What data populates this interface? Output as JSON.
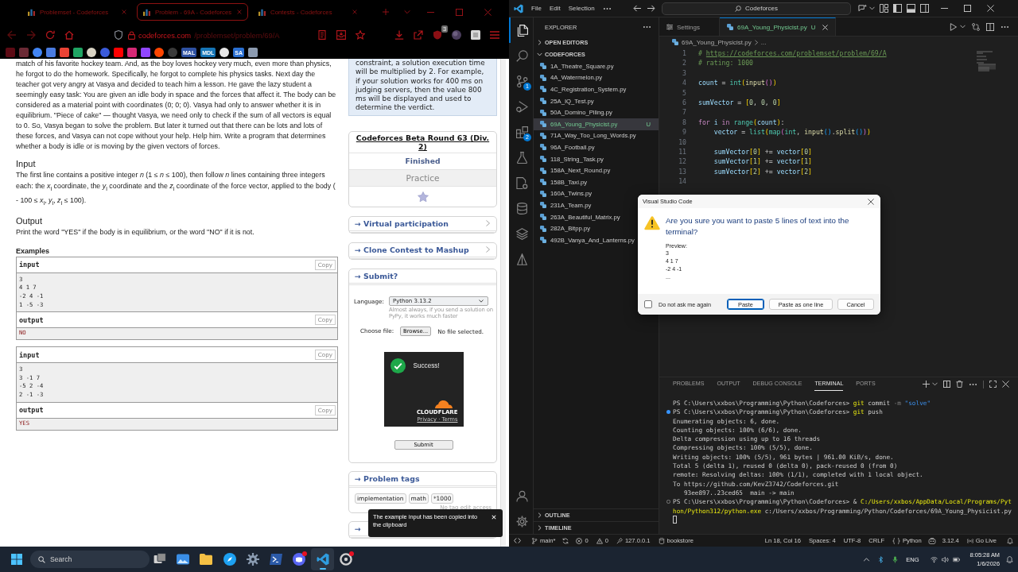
{
  "browser": {
    "tabs": [
      {
        "title": "Problemset - Codeforces",
        "selected": false
      },
      {
        "title": "Problem - 69A - Codeforces",
        "selected": true
      },
      {
        "title": "Contests - Codeforces",
        "selected": false
      }
    ],
    "url": {
      "host": "codeforces.com",
      "path": "/problemset/problem/69/A"
    },
    "extension_badge": "3",
    "bookmarks": [
      {
        "kind": "tile",
        "color": "#5c0a14"
      },
      {
        "kind": "tile",
        "color": "#6b2a35"
      },
      {
        "kind": "circle",
        "color": "#4285f4"
      },
      {
        "kind": "tile",
        "color": "#4a7be0"
      },
      {
        "kind": "tile",
        "color": "#ea4335"
      },
      {
        "kind": "tile",
        "color": "#1fa463"
      },
      {
        "kind": "circle",
        "color": "#d9d4c4"
      },
      {
        "kind": "circle",
        "color": "#3b5bdb"
      },
      {
        "kind": "tile",
        "color": "#ff0000"
      },
      {
        "kind": "tile",
        "color": "#d62976"
      },
      {
        "kind": "tile",
        "color": "#9146ff"
      },
      {
        "kind": "circle",
        "color": "#ff4500"
      },
      {
        "kind": "circle",
        "color": "#3a3a3a"
      },
      {
        "kind": "text",
        "label": "MAL",
        "color": "#2e51a2"
      },
      {
        "kind": "text",
        "label": "MDL",
        "color": "#1675b6"
      },
      {
        "kind": "circle",
        "color": "#e8e8e8"
      },
      {
        "kind": "text",
        "label": "SA",
        "color": "#2a6fd1"
      },
      {
        "kind": "tile",
        "color": "#8c9bb0"
      }
    ]
  },
  "problem": {
    "statement": "match of his favorite hockey team. And, as the boy loves hockey very much, even more than physics, he forgot to do the homework. Specifically, he forgot to complete his physics tasks. Next day the teacher got very angry at Vasya and decided to teach him a lesson. He gave the lazy student a seemingly easy task: You are given an idle body in space and the forces that affect it. The body can be considered as a material point with coordinates (0; 0; 0). Vasya had only to answer whether it is in equilibrium. \"Piece of cake\" — thought Vasya, we need only to check if the sum of all vectors is equal to 0. So, Vasya began to solve the problem. But later it turned out that there can be lots and lots of these forces, and Vasya can not cope without your help. Help him. Write a program that determines whether a body is idle or is moving by the given vectors of forces.",
    "sections": [
      {
        "title": "Input",
        "text": "The first line contains a positive integer *n* (1 ≤ *n* ≤ 100), then follow *n* lines containing three integers each: the *x*$_{i}$ coordinate, the *y*$_{i}$ coordinate and the *z*$_{i}$ coordinate of the force vector, applied to the body ( - 100 ≤ *x*$_{i}$, *y*$_{i}$, *z*$_{i}$ ≤ 100)."
      },
      {
        "title": "Output",
        "text": "Print the word \"YES\" if the body is in equilibrium, or the word \"NO\" if it is not."
      }
    ],
    "examples_title": "Examples",
    "examples": [
      {
        "input_label": "input",
        "input_copy": "Copy",
        "input_lines": [
          "3",
          "4 1 7",
          "-2 4 -1",
          "1 -5 -3"
        ],
        "output_label": "output",
        "output_copy": "Copy",
        "output_lines": [
          "NO"
        ]
      },
      {
        "input_label": "input",
        "input_copy": "Copy",
        "input_lines": [
          "3",
          "3 -1 7",
          "-5 2 -4",
          "2 -1 -3"
        ],
        "output_label": "output",
        "output_copy": "Copy",
        "output_lines": [
          "YES"
        ]
      }
    ]
  },
  "sidebar": {
    "note": "constraint, a solution execution time will be multiplied by 2. For example, if your solution works for 400 ms on judging servers, then the value 800 ms will be displayed and used to determine the verdict.",
    "contest": {
      "name": "Codeforces Beta Round 63 (Div. 2)",
      "status": "Finished",
      "mode": "Practice"
    },
    "links": [
      "→ Virtual participation",
      "→ Clone Contest to Mashup"
    ],
    "submit": {
      "title": "→ Submit?",
      "language_label": "Language:",
      "language": "Python 3.13.2",
      "language_hint": "Almost always, if you send a solution on PyPy, it works much faster",
      "file_label": "Choose file:",
      "browse": "Browse...",
      "file_status": "No file selected.",
      "captcha": {
        "status": "Success!",
        "brand": "CLOUDFLARE",
        "legal": "Privacy · Terms"
      },
      "button": "Submit"
    },
    "tags": {
      "title": "→ Problem tags",
      "items": [
        "implementation",
        "math",
        "*1000"
      ],
      "note": "No tag edit access"
    },
    "materials_title": "→"
  },
  "toast": {
    "text": "The example input has been copied into the clipboard"
  },
  "vscode": {
    "menu": [
      "File",
      "Edit",
      "Selection"
    ],
    "search": "Codeforces",
    "activity": [
      {
        "kind": "files",
        "selected": true
      },
      {
        "kind": "search",
        "selected": false
      },
      {
        "kind": "source-control",
        "selected": false,
        "badge": "1"
      },
      {
        "kind": "run",
        "selected": false
      },
      {
        "kind": "extensions",
        "selected": false,
        "badge": "2"
      },
      {
        "kind": "testing",
        "selected": false
      },
      {
        "kind": "remote",
        "selected": false
      },
      {
        "kind": "database",
        "selected": false
      },
      {
        "kind": "layers",
        "selected": false
      },
      {
        "kind": "deploy",
        "selected": false
      }
    ],
    "explorer": {
      "title": "EXPLORER",
      "sections": [
        {
          "title": "OPEN EDITORS",
          "expanded": false
        },
        {
          "title": "CODEFORCES",
          "expanded": true,
          "files": [
            {
              "name": "1A_Theatre_Square.py",
              "selected": false
            },
            {
              "name": "4A_Watermelon.py",
              "selected": false
            },
            {
              "name": "4C_Registration_System.py",
              "selected": false
            },
            {
              "name": "25A_IQ_Test.py",
              "selected": false
            },
            {
              "name": "50A_Domino_Piling.py",
              "selected": false
            },
            {
              "name": "69A_Young_Physicist.py",
              "selected": true,
              "status": "U"
            },
            {
              "name": "71A_Way_Too_Long_Words.py",
              "selected": false
            },
            {
              "name": "96A_Football.py",
              "selected": false
            },
            {
              "name": "118_String_Task.py",
              "selected": false
            },
            {
              "name": "158A_Next_Round.py",
              "selected": false
            },
            {
              "name": "158B_Taxi.py",
              "selected": false
            },
            {
              "name": "160A_Twins.py",
              "selected": false
            },
            {
              "name": "231A_Team.py",
              "selected": false
            },
            {
              "name": "263A_Beautiful_Matrix.py",
              "selected": false
            },
            {
              "name": "282A_Bitpp.py",
              "selected": false
            },
            {
              "name": "492B_Vanya_And_Lanterns.py",
              "selected": false
            }
          ]
        }
      ],
      "bottom_sections": [
        {
          "title": "OUTLINE",
          "expanded": false
        },
        {
          "title": "TIMELINE",
          "expanded": false
        }
      ]
    },
    "editor": {
      "tabs": [
        {
          "title": "Settings",
          "kind": "settings",
          "selected": false
        },
        {
          "title": "69A_Young_Physicist.py",
          "kind": "python",
          "selected": true,
          "status": "U"
        }
      ],
      "breadcrumb": [
        "69A_Young_Physicist.py",
        "..."
      ],
      "lines": [
        {
          "number": "1",
          "tokens": [
            {
              "text": "# ",
              "kind": "comment"
            },
            {
              "text": "https://codeforces.com/problemset/problem/69/A",
              "kind": "link"
            }
          ]
        },
        {
          "number": "2",
          "tokens": [
            {
              "text": "# rating: 1000",
              "kind": "comment"
            }
          ]
        },
        {
          "number": "3"
        },
        {
          "number": "4",
          "tokens": [
            {
              "text": "count",
              "kind": "variable"
            },
            {
              "text": " = ",
              "kind": "operator"
            },
            {
              "text": "int",
              "kind": "class"
            },
            {
              "text": "(",
              "kind": "bracket-1"
            },
            {
              "text": "input",
              "kind": "function"
            },
            {
              "text": "()",
              "kind": "bracket-2"
            },
            {
              "text": ")",
              "kind": "bracket-1"
            }
          ]
        },
        {
          "number": "5"
        },
        {
          "number": "6",
          "tokens": [
            {
              "text": "sumVector",
              "kind": "variable"
            },
            {
              "text": " = ",
              "kind": "operator"
            },
            {
              "text": "[",
              "kind": "bracket-1"
            },
            {
              "text": "0",
              "kind": "number"
            },
            {
              "text": ", ",
              "kind": "operator"
            },
            {
              "text": "0",
              "kind": "number"
            },
            {
              "text": ", ",
              "kind": "operator"
            },
            {
              "text": "0",
              "kind": "number"
            },
            {
              "text": "]",
              "kind": "bracket-1"
            }
          ]
        },
        {
          "number": "7"
        },
        {
          "number": "8",
          "tokens": [
            {
              "text": "for ",
              "kind": "keyword"
            },
            {
              "text": "i ",
              "kind": "variable"
            },
            {
              "text": "in ",
              "kind": "keyword"
            },
            {
              "text": "range",
              "kind": "class"
            },
            {
              "text": "(",
              "kind": "bracket-1"
            },
            {
              "text": "count",
              "kind": "variable"
            },
            {
              "text": ")",
              "kind": "bracket-1"
            },
            {
              "text": ":",
              "kind": "operator"
            }
          ]
        },
        {
          "number": "9",
          "tokens": [
            {
              "text": "    vector",
              "kind": "variable"
            },
            {
              "text": " = ",
              "kind": "operator"
            },
            {
              "text": "list",
              "kind": "class"
            },
            {
              "text": "(",
              "kind": "bracket-1"
            },
            {
              "text": "map",
              "kind": "class"
            },
            {
              "text": "(",
              "kind": "bracket-2"
            },
            {
              "text": "int",
              "kind": "class"
            },
            {
              "text": ", ",
              "kind": "operator"
            },
            {
              "text": "input",
              "kind": "function"
            },
            {
              "text": "()",
              "kind": "bracket-3"
            },
            {
              "text": ".",
              "kind": "operator"
            },
            {
              "text": "split",
              "kind": "function"
            },
            {
              "text": "()",
              "kind": "bracket-3"
            },
            {
              "text": ")",
              "kind": "bracket-2"
            },
            {
              "text": ")",
              "kind": "bracket-1"
            }
          ]
        },
        {
          "number": "10"
        },
        {
          "number": "11",
          "tokens": [
            {
              "text": "    sumVector",
              "kind": "variable"
            },
            {
              "text": "[",
              "kind": "bracket-1"
            },
            {
              "text": "0",
              "kind": "number"
            },
            {
              "text": "]",
              "kind": "bracket-1"
            },
            {
              "text": " += ",
              "kind": "operator"
            },
            {
              "text": "vector",
              "kind": "variable"
            },
            {
              "text": "[",
              "kind": "bracket-1"
            },
            {
              "text": "0",
              "kind": "number"
            },
            {
              "text": "]",
              "kind": "bracket-1"
            }
          ]
        },
        {
          "number": "12",
          "tokens": [
            {
              "text": "    sumVector",
              "kind": "variable"
            },
            {
              "text": "[",
              "kind": "bracket-1"
            },
            {
              "text": "1",
              "kind": "number"
            },
            {
              "text": "]",
              "kind": "bracket-1"
            },
            {
              "text": " += ",
              "kind": "operator"
            },
            {
              "text": "vector",
              "kind": "variable"
            },
            {
              "text": "[",
              "kind": "bracket-1"
            },
            {
              "text": "1",
              "kind": "number"
            },
            {
              "text": "]",
              "kind": "bracket-1"
            }
          ]
        },
        {
          "number": "13",
          "tokens": [
            {
              "text": "    sumVector",
              "kind": "variable"
            },
            {
              "text": "[",
              "kind": "bracket-1"
            },
            {
              "text": "2",
              "kind": "number"
            },
            {
              "text": "]",
              "kind": "bracket-1"
            },
            {
              "text": " += ",
              "kind": "operator"
            },
            {
              "text": "vector",
              "kind": "variable"
            },
            {
              "text": "[",
              "kind": "bracket-1"
            },
            {
              "text": "2",
              "kind": "number"
            },
            {
              "text": "]",
              "kind": "bracket-1"
            }
          ]
        },
        {
          "number": "14"
        }
      ]
    },
    "panel": {
      "tabs": [
        {
          "title": "PROBLEMS",
          "selected": false
        },
        {
          "title": "OUTPUT",
          "selected": false
        },
        {
          "title": "DEBUG CONSOLE",
          "selected": false
        },
        {
          "title": "TERMINAL",
          "selected": true
        },
        {
          "title": "PORTS",
          "selected": false
        }
      ],
      "terminal": [
        {
          "kind": "command",
          "tokens": [
            {
              "text": "PS C:\\Users\\xxbos\\Programming\\Python\\Codeforces> ",
              "kind": "text"
            },
            {
              "text": "git",
              "kind": "command"
            },
            {
              "text": " commit ",
              "kind": "text"
            },
            {
              "text": "-m",
              "kind": "flag"
            },
            {
              "text": " \"solve\"",
              "kind": "string"
            }
          ]
        },
        {
          "kind": "command-success",
          "tokens": [
            {
              "text": "PS C:\\Users\\xxbos\\Programming\\Python\\Codeforces> ",
              "kind": "text"
            },
            {
              "text": "git",
              "kind": "command"
            },
            {
              "text": " push",
              "kind": "text"
            }
          ]
        },
        {
          "kind": "output",
          "text": "Enumerating objects: 6, done."
        },
        {
          "kind": "output",
          "text": "Counting objects: 100% (6/6), done."
        },
        {
          "kind": "output",
          "text": "Delta compression using up to 16 threads"
        },
        {
          "kind": "output",
          "text": "Compressing objects: 100% (5/5), done."
        },
        {
          "kind": "output",
          "text": "Writing objects: 100% (5/5), 961 bytes | 961.00 KiB/s, done."
        },
        {
          "kind": "output",
          "text": "Total 5 (delta 1), reused 0 (delta 0), pack-reused 0 (from 0)"
        },
        {
          "kind": "output",
          "text": "remote: Resolving deltas: 100% (1/1), completed with 1 local object."
        },
        {
          "kind": "output",
          "text": "To https://github.com/KevZ3742/Codeforces.git"
        },
        {
          "kind": "output",
          "text": "   93ee897..23ced65  main -> main"
        },
        {
          "kind": "command-running",
          "tokens": [
            {
              "text": "PS C:\\Users\\xxbos\\Programming\\Python\\Codeforces> & ",
              "kind": "text"
            },
            {
              "text": "C:/Users/xxbos/AppData/Local/Programs/Python/Python312/python.exe",
              "kind": "path"
            },
            {
              "text": " c:/Users/xxbos/Programming/Python/Codeforces/69A_Young_Physicist.py",
              "kind": "text"
            }
          ]
        }
      ]
    },
    "status_bar": {
      "branch": "main*",
      "errors": "0",
      "warnings": "0",
      "port": "127.0.0.1",
      "database": "bookstore",
      "position": "Ln 18, Col 16",
      "indent": "Spaces: 4",
      "encoding": "UTF-8",
      "eol": "CRLF",
      "language": "Python",
      "interpreter": "3.12.4",
      "live": "Go Live"
    }
  },
  "dialog": {
    "title": "Visual Studio Code",
    "message": "Are you sure you want to paste 5 lines of text into the terminal?",
    "preview_label": "Preview:",
    "preview": [
      "3",
      "4 1 7",
      "-2 4 -1",
      "..."
    ],
    "checkbox": {
      "label": "Do not ask me again",
      "checked": false
    },
    "buttons": [
      {
        "label": "Paste",
        "selected": true
      },
      {
        "label": "Paste as one line",
        "selected": false
      },
      {
        "label": "Cancel",
        "selected": false
      }
    ]
  },
  "taskbar": {
    "search": {
      "placeholder": "Search"
    },
    "apps": [
      {
        "kind": "task-view",
        "selected": false,
        "badge": false
      },
      {
        "kind": "photos",
        "selected": false,
        "badge": false
      },
      {
        "kind": "folder",
        "selected": false,
        "badge": false
      },
      {
        "kind": "compass",
        "selected": false,
        "badge": false
      },
      {
        "kind": "settings",
        "selected": false,
        "badge": false
      },
      {
        "kind": "terminal",
        "selected": false,
        "badge": false
      },
      {
        "kind": "chat",
        "selected": false,
        "badge": true
      },
      {
        "kind": "code",
        "selected": true,
        "badge": false
      },
      {
        "kind": "circle",
        "selected": false,
        "badge": true
      }
    ],
    "language": "ENG",
    "time": "8:05:28 AM",
    "date": "1/6/2026"
  }
}
